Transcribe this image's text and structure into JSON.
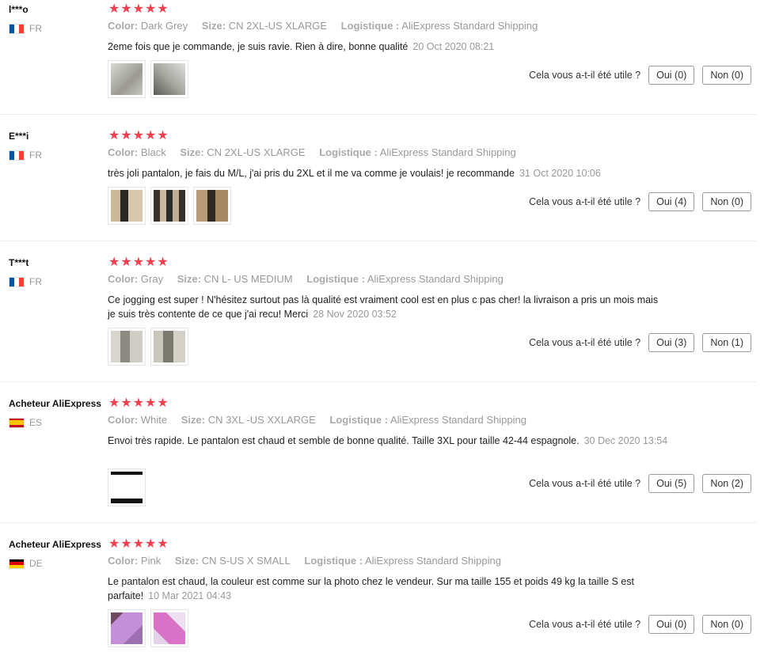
{
  "labels": {
    "color": "Color:",
    "size": "Size:",
    "logistics": "Logistique :",
    "helpful": "Cela vous a-t-il été utile ?"
  },
  "stars": "★★★★★",
  "reviews": [
    {
      "user": "l***o",
      "country": "FR",
      "color": "Dark Grey",
      "size": "CN 2XL-US XLARGE",
      "logistics": "AliExpress Standard Shipping",
      "text": "2eme fois que je commande, je suis ravie. Rien à dire, bonne qualité",
      "date": "20 Oct 2020 08:21",
      "yes": "Oui (0)",
      "no": "Non (0)"
    },
    {
      "user": "E***i",
      "country": "FR",
      "color": "Black",
      "size": "CN 2XL-US XLARGE",
      "logistics": "AliExpress Standard Shipping",
      "text": "très joli pantalon, je fais du M/L, j'ai pris du 2XL et il me va comme je voulais! je recommande",
      "date": "31 Oct 2020 10:06",
      "yes": "Oui (4)",
      "no": "Non (0)"
    },
    {
      "user": "T***t",
      "country": "FR",
      "color": "Gray",
      "size": "CN L- US MEDIUM",
      "logistics": "AliExpress Standard Shipping",
      "text": "Ce jogging est super ! N'hésitez surtout pas là qualité est vraiment cool est en plus c pas cher! la livraison a pris un mois mais je suis très contente de ce que j'ai recu! Merci",
      "date": "28 Nov 2020 03:52",
      "yes": "Oui (3)",
      "no": "Non (1)"
    },
    {
      "user": "Acheteur AliExpress",
      "country": "ES",
      "color": "White",
      "size": "CN 3XL -US XXLARGE",
      "logistics": "AliExpress Standard Shipping",
      "text": "Envoi très rapide. Le pantalon est chaud et semble de bonne qualité. Taille 3XL pour taille 42-44 espagnole.",
      "date": "30 Dec 2020 13:54",
      "yes": "Oui (5)",
      "no": "Non (2)"
    },
    {
      "user": "Acheteur AliExpress",
      "country": "DE",
      "color": "Pink",
      "size": "CN S-US X SMALL",
      "logistics": "AliExpress Standard Shipping",
      "text": "Le pantalon est chaud, la couleur est comme sur la photo chez le vendeur. Sur ma taille 155 et poids 49 kg la taille S est parfaite!",
      "date": "10 Mar 2021 04:43",
      "yes": "Oui (0)",
      "no": "Non (0)"
    }
  ]
}
